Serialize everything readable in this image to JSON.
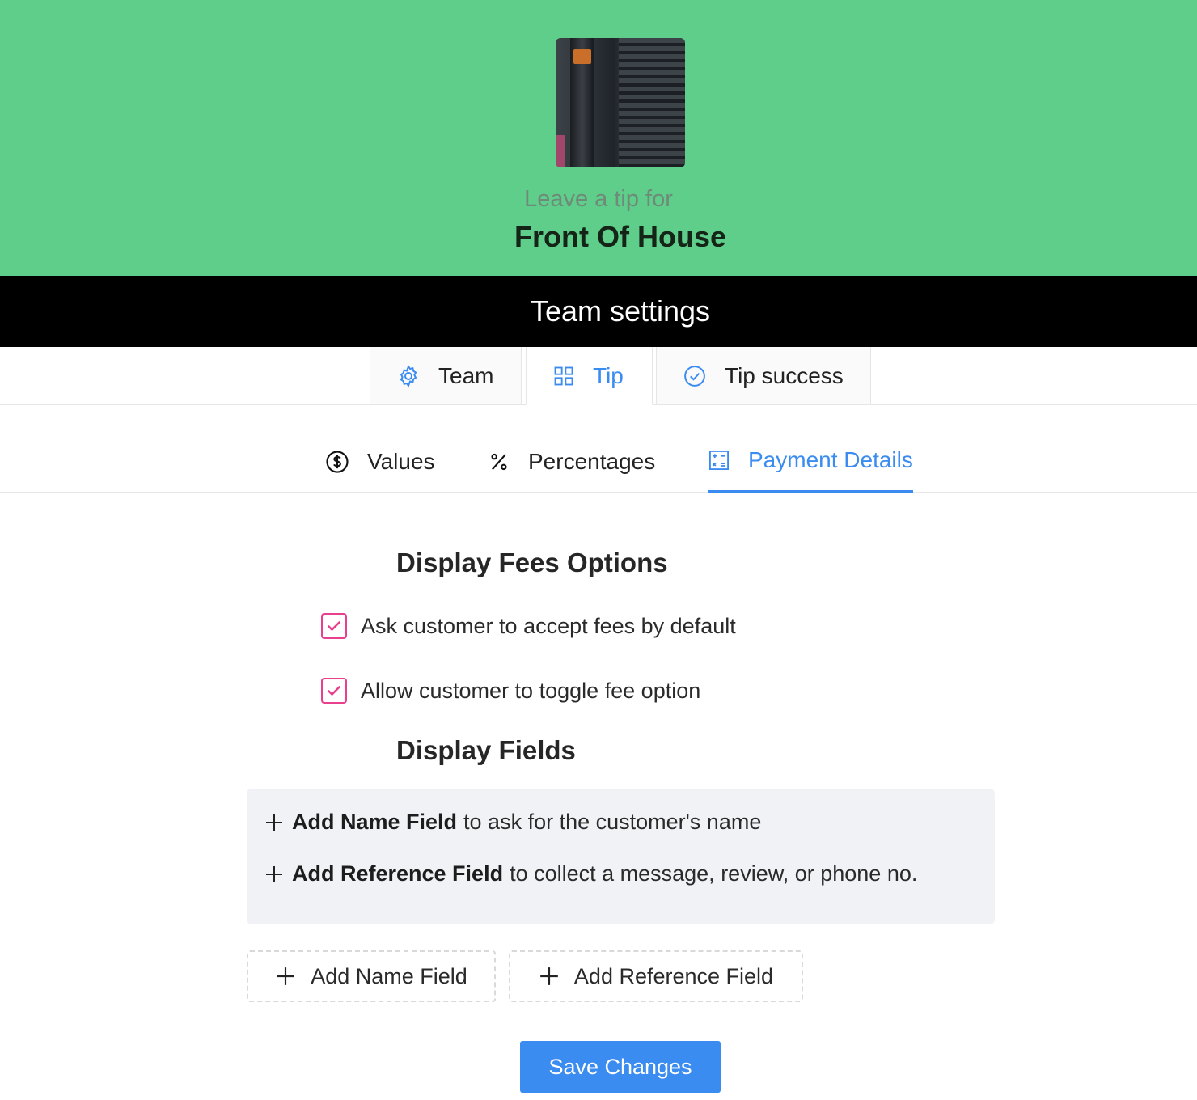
{
  "header": {
    "lead_text": "Leave a tip for",
    "team_name": "Front Of House",
    "background_color": "#5fce8a"
  },
  "title_bar": {
    "title": "Team settings"
  },
  "top_tabs": [
    {
      "label": "Team",
      "icon": "gear-icon",
      "active": false
    },
    {
      "label": "Tip",
      "icon": "grid-icon",
      "active": true
    },
    {
      "label": "Tip success",
      "icon": "check-circle-icon",
      "active": false
    }
  ],
  "sub_tabs": [
    {
      "label": "Values",
      "icon": "dollar-circle-icon",
      "active": false
    },
    {
      "label": "Percentages",
      "icon": "percent-icon",
      "active": false
    },
    {
      "label": "Payment Details",
      "icon": "calculator-icon",
      "active": true
    }
  ],
  "fees": {
    "title": "Display Fees Options",
    "options": [
      {
        "label": "Ask customer to accept fees by default",
        "checked": true
      },
      {
        "label": "Allow customer to toggle fee option",
        "checked": true
      }
    ]
  },
  "fields": {
    "title": "Display Fields",
    "hints": [
      {
        "bold": "Add Name Field",
        "rest": "to ask for the customer's name"
      },
      {
        "bold": "Add Reference Field",
        "rest": "to collect a message, review, or phone no."
      }
    ],
    "add_name_label": "Add Name Field",
    "add_reference_label": "Add Reference Field"
  },
  "save_label": "Save Changes",
  "colors": {
    "accent": "#3b8cf0",
    "checkbox": "#e8408e"
  }
}
